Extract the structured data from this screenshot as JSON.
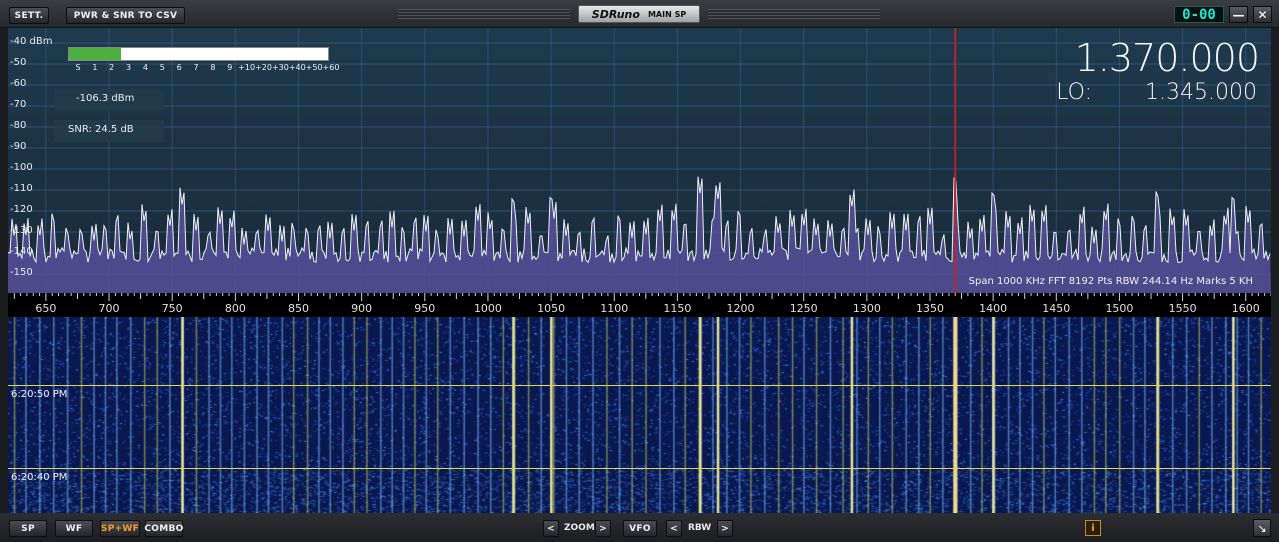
{
  "titlebar": {
    "settings_label": "SETT.",
    "csv_label": "PWR & SNR TO CSV",
    "app_name": "SDRuno",
    "app_subtitle": "MAIN SP",
    "time_display": "0-00",
    "minimize_icon": "minimize-icon",
    "close_icon": "close-icon"
  },
  "spectrum": {
    "db_unit": "dBm",
    "db_levels": [
      -40,
      -50,
      -60,
      -70,
      -80,
      -90,
      -100,
      -110,
      -120,
      -130,
      -140,
      -150
    ],
    "smeter": {
      "level_fraction": 0.2,
      "marks": [
        "S",
        "1",
        "2",
        "3",
        "4",
        "5",
        "6",
        "7",
        "8",
        "9",
        "+10",
        "+20",
        "+30",
        "+40",
        "+50",
        "+60"
      ]
    },
    "power_readout": "-106.3 dBm",
    "snr_readout": "SNR: 24.5 dB",
    "frequency_display": "1.370.000",
    "lo_label": "LO:",
    "lo_display": "1.345.000",
    "span_info": "Span 1000 KHz   FFT 8192 Pts   RBW 244.14 Hz   Marks 5 KH",
    "colors": {
      "trace": "#f0f2f5",
      "floor_fill": "#56509a",
      "grid": "#3f6a9a",
      "marker": "#c8202c"
    }
  },
  "scale": {
    "labels": [
      "650",
      "700",
      "750",
      "800",
      "850",
      "900",
      "950",
      "1000",
      "1050",
      "1100",
      "1150",
      "1200",
      "1250",
      "1300",
      "1350",
      "1400",
      "1450",
      "1500",
      "1550",
      "1600"
    ],
    "min_khz": 620,
    "max_khz": 1620,
    "marker_khz": 1370
  },
  "waterfall": {
    "time_labels": [
      "6:20:50 PM",
      "6:20:40 PM"
    ],
    "colors": {
      "base": "#0a1850",
      "guide_line": "#e4d84a"
    }
  },
  "bottombar": {
    "sp": "SP",
    "wf": "WF",
    "sp_wf": "SP+WF",
    "combo": "COMBO",
    "zoom_prev": "<",
    "zoom_label": "ZOOM",
    "zoom_next": ">",
    "vfo": "VFO",
    "rbw_prev": "<",
    "rbw_label": "RBW",
    "rbw_next": ">",
    "info": "i",
    "resize_icon": "resize-icon"
  }
}
